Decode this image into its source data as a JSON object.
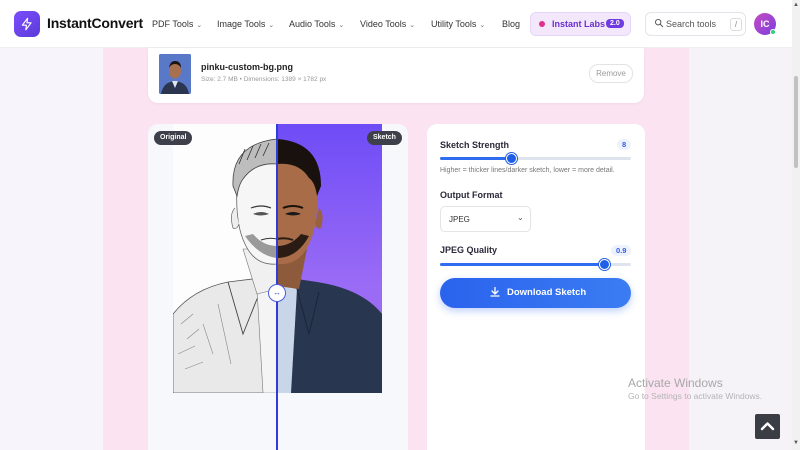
{
  "header": {
    "logo_text": "InstantConvert",
    "nav": [
      {
        "label": "PDF Tools"
      },
      {
        "label": "Image Tools"
      },
      {
        "label": "Audio Tools"
      },
      {
        "label": "Video Tools"
      },
      {
        "label": "Utility Tools"
      },
      {
        "label": "Blog"
      }
    ],
    "labs": {
      "label": "Instant Labs",
      "badge": "2.0"
    },
    "search": {
      "placeholder": "Search tools",
      "shortcut": "/"
    },
    "avatar_initials": "IC"
  },
  "file": {
    "name": "pinku-custom-bg.png",
    "meta": "Size: 2.7 MB • Dimensions: 1389 × 1782 px",
    "remove_label": "Remove"
  },
  "preview": {
    "original_label": "Original",
    "sketch_label": "Sketch",
    "handle_glyph": "↔"
  },
  "settings": {
    "sketch_strength": {
      "label": "Sketch Strength",
      "value": "8",
      "min": 1,
      "max": 20,
      "fraction": 0.37
    },
    "hint": "Higher = thicker lines/darker sketch, lower = more detail.",
    "output_format": {
      "label": "Output Format",
      "selected": "JPEG"
    },
    "jpeg_quality": {
      "label": "JPEG Quality",
      "value": "0.9",
      "fraction": 0.86
    },
    "download_label": "Download Sketch"
  },
  "watermark": {
    "title": "Activate Windows",
    "subtitle": "Go to Settings to activate Windows."
  },
  "colors": {
    "accent": "#2f6cf0",
    "brand": "#6d3be0",
    "page_band": "#fbe3f2"
  }
}
